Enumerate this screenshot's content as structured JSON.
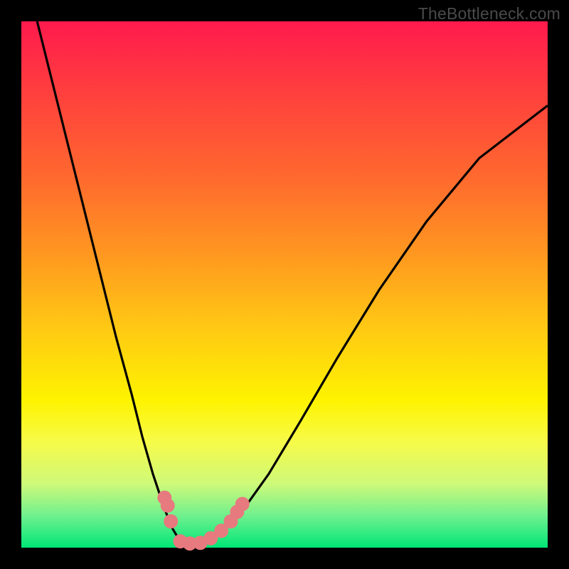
{
  "watermark": "TheBottleneck.com",
  "chart_data": {
    "type": "line",
    "title": "",
    "xlabel": "",
    "ylabel": "",
    "xlim": [
      0,
      100
    ],
    "ylim": [
      0,
      100
    ],
    "series": [
      {
        "name": "bottleneck-curve",
        "x": [
          3,
          6,
          9,
          12,
          15,
          18,
          21,
          23,
          25,
          27,
          28.5,
          30,
          31.5,
          33,
          35,
          38,
          42,
          47,
          53,
          60,
          68,
          77,
          87,
          100
        ],
        "y": [
          100,
          88,
          76,
          64,
          52,
          40,
          29,
          21,
          14,
          8,
          4,
          1.5,
          0.8,
          0.8,
          1.2,
          3,
          7,
          14,
          24,
          36,
          49,
          62,
          74,
          84
        ]
      }
    ],
    "markers": [
      {
        "name": "marker-left-1",
        "x": 27.2,
        "y": 9.5
      },
      {
        "name": "marker-left-2",
        "x": 27.8,
        "y": 8.0
      },
      {
        "name": "marker-left-3",
        "x": 28.4,
        "y": 5.0
      },
      {
        "name": "marker-bottom-1",
        "x": 30.2,
        "y": 1.2
      },
      {
        "name": "marker-bottom-2",
        "x": 32.0,
        "y": 0.8
      },
      {
        "name": "marker-bottom-3",
        "x": 34.0,
        "y": 0.9
      },
      {
        "name": "marker-bottom-4",
        "x": 36.0,
        "y": 1.8
      },
      {
        "name": "marker-bottom-5",
        "x": 38.0,
        "y": 3.2
      },
      {
        "name": "marker-right-1",
        "x": 39.8,
        "y": 5.0
      },
      {
        "name": "marker-right-2",
        "x": 41.0,
        "y": 6.8
      },
      {
        "name": "marker-right-3",
        "x": 42.0,
        "y": 8.3
      }
    ],
    "marker_color": "#e77a7e",
    "curve_color": "#000000",
    "frame_color": "#000000"
  }
}
